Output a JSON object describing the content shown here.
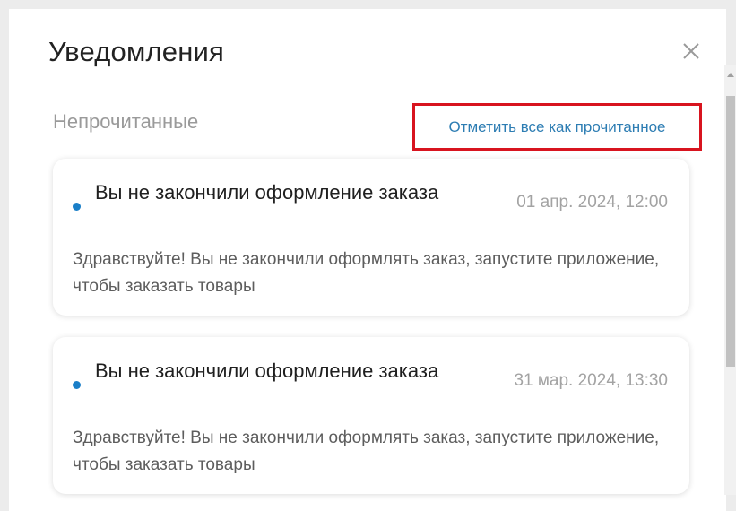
{
  "dialog": {
    "title": "Уведомления",
    "close_icon": "close-icon"
  },
  "section": {
    "label": "Непрочитанные",
    "mark_all_label": "Отметить все как прочитанное"
  },
  "notifications": [
    {
      "unread": true,
      "title": "Вы не закончили оформление заказа",
      "date": "01 апр. 2024, 12:00",
      "body": "Здравствуйте! Вы не закончили оформлять заказ, запустите приложение, чтобы заказать товары"
    },
    {
      "unread": true,
      "title": "Вы не закончили оформление заказа",
      "date": "31 мар. 2024, 13:30",
      "body": "Здравствуйте! Вы не закончили оформлять заказ, запустите приложение, чтобы заказать товары"
    }
  ],
  "colors": {
    "accent_link": "#2d7db3",
    "unread_dot": "#1a7fc8",
    "highlight_border": "#d8141f"
  }
}
